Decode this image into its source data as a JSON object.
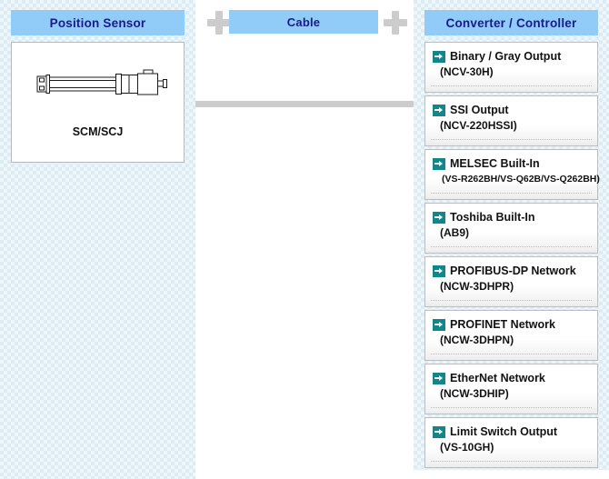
{
  "columns": {
    "position_sensor": {
      "header": "Position Sensor",
      "card": {
        "label": "SCM/SCJ",
        "image_name": "linear-position-sensor-cylinder"
      }
    },
    "cable": {
      "header": "Cable",
      "plus_left": "+",
      "plus_right": "+"
    },
    "converter": {
      "header": "Converter / Controller",
      "items": [
        {
          "title": "Binary / Gray Output",
          "model": "(NCV-30H)",
          "small_model": false
        },
        {
          "title": "SSI Output",
          "model": "(NCV-220HSSI)",
          "small_model": false
        },
        {
          "title": "MELSEC Built-In",
          "model": "(VS-R262BH/VS-Q62B/VS-Q262BH)",
          "small_model": true
        },
        {
          "title": "Toshiba Built-In",
          "model": "(AB9)",
          "small_model": false
        },
        {
          "title": "PROFIBUS-DP Network",
          "model": "(NCW-3DHPR)",
          "small_model": false
        },
        {
          "title": "PROFINET Network",
          "model": "(NCW-3DHPN)",
          "small_model": false
        },
        {
          "title": "EtherNet Network",
          "model": "(NCW-3DHIP)",
          "small_model": false
        },
        {
          "title": "Limit Switch Output",
          "model": "(VS-10GH)",
          "small_model": false
        }
      ]
    }
  },
  "colors": {
    "header_bg": "#90ccf7",
    "header_text": "#1a1a8c",
    "panel_bg": "#dcecf4",
    "arrow_icon": "#11878c",
    "connector": "#cccccc",
    "plus": "#cccccc"
  }
}
